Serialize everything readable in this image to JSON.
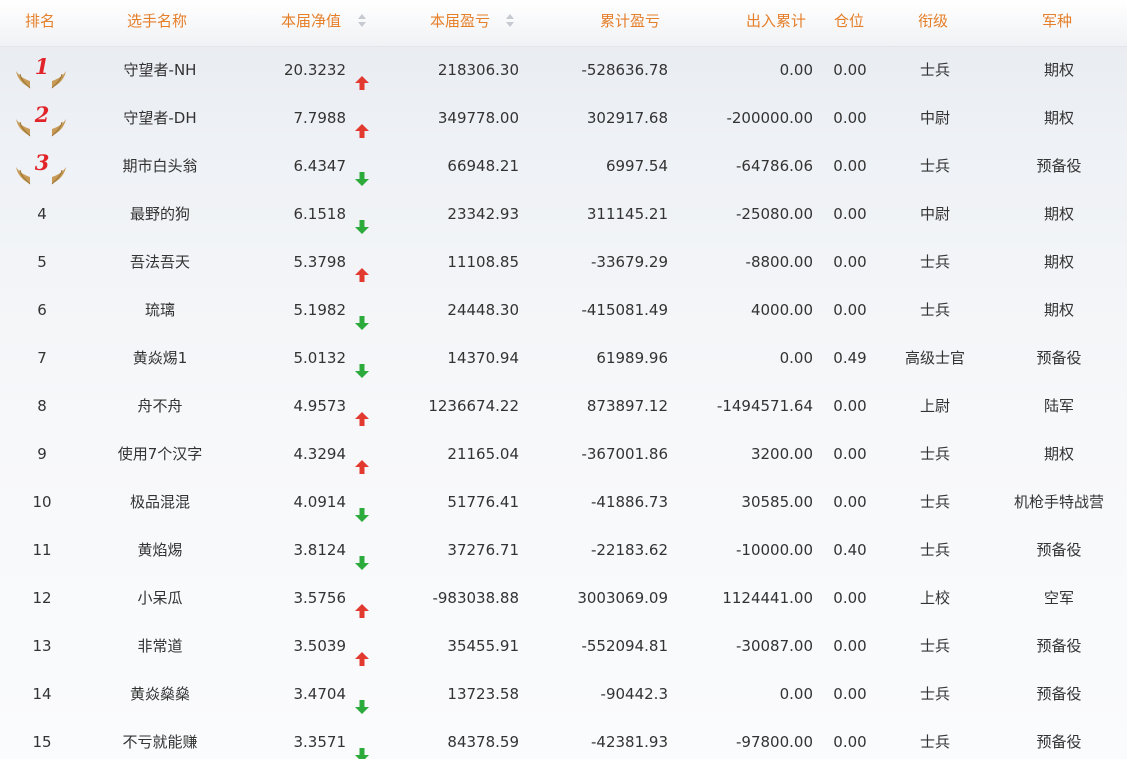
{
  "colors": {
    "header_text": "#e57f2a",
    "up_arrow": "#e23a2f",
    "down_arrow": "#2cab3c",
    "medal_number": "#e0242a",
    "wing_gold": "#c79a55"
  },
  "headers": {
    "rank": "排名",
    "name": "选手名称",
    "nav": "本届净值",
    "profit": "本届盈亏",
    "total_profit": "累计盈亏",
    "cash_flow": "出入累计",
    "position": "仓位",
    "military_rank": "衔级",
    "arm": "军种"
  },
  "rows": [
    {
      "rank": "1",
      "medal": true,
      "name": "守望者-NH",
      "nav": "20.3232",
      "trend": "up",
      "profit": "218306.30",
      "total_profit": "-528636.78",
      "cash_flow": "0.00",
      "position": "0.00",
      "military_rank": "士兵",
      "arm": "期权"
    },
    {
      "rank": "2",
      "medal": true,
      "name": "守望者-DH",
      "nav": "7.7988",
      "trend": "up",
      "profit": "349778.00",
      "total_profit": "302917.68",
      "cash_flow": "-200000.00",
      "position": "0.00",
      "military_rank": "中尉",
      "arm": "期权"
    },
    {
      "rank": "3",
      "medal": true,
      "name": "期市白头翁",
      "nav": "6.4347",
      "trend": "down",
      "profit": "66948.21",
      "total_profit": "6997.54",
      "cash_flow": "-64786.06",
      "position": "0.00",
      "military_rank": "士兵",
      "arm": "预备役"
    },
    {
      "rank": "4",
      "medal": false,
      "name": "最野的狗",
      "nav": "6.1518",
      "trend": "down",
      "profit": "23342.93",
      "total_profit": "311145.21",
      "cash_flow": "-25080.00",
      "position": "0.00",
      "military_rank": "中尉",
      "arm": "期权"
    },
    {
      "rank": "5",
      "medal": false,
      "name": "吾法吾天",
      "nav": "5.3798",
      "trend": "up",
      "profit": "11108.85",
      "total_profit": "-33679.29",
      "cash_flow": "-8800.00",
      "position": "0.00",
      "military_rank": "士兵",
      "arm": "期权"
    },
    {
      "rank": "6",
      "medal": false,
      "name": "琉璃",
      "nav": "5.1982",
      "trend": "down",
      "profit": "24448.30",
      "total_profit": "-415081.49",
      "cash_flow": "4000.00",
      "position": "0.00",
      "military_rank": "士兵",
      "arm": "期权"
    },
    {
      "rank": "7",
      "medal": false,
      "name": "黄焱焬1",
      "nav": "5.0132",
      "trend": "down",
      "profit": "14370.94",
      "total_profit": "61989.96",
      "cash_flow": "0.00",
      "position": "0.49",
      "military_rank": "高级士官",
      "arm": "预备役"
    },
    {
      "rank": "8",
      "medal": false,
      "name": "舟不舟",
      "nav": "4.9573",
      "trend": "up",
      "profit": "1236674.22",
      "total_profit": "873897.12",
      "cash_flow": "-1494571.64",
      "position": "0.00",
      "military_rank": "上尉",
      "arm": "陆军"
    },
    {
      "rank": "9",
      "medal": false,
      "name": "使用7个汉字",
      "nav": "4.3294",
      "trend": "up",
      "profit": "21165.04",
      "total_profit": "-367001.86",
      "cash_flow": "3200.00",
      "position": "0.00",
      "military_rank": "士兵",
      "arm": "期权"
    },
    {
      "rank": "10",
      "medal": false,
      "name": "极品混混",
      "nav": "4.0914",
      "trend": "down",
      "profit": "51776.41",
      "total_profit": "-41886.73",
      "cash_flow": "30585.00",
      "position": "0.00",
      "military_rank": "士兵",
      "arm": "机枪手特战营"
    },
    {
      "rank": "11",
      "medal": false,
      "name": "黄焰焬",
      "nav": "3.8124",
      "trend": "down",
      "profit": "37276.71",
      "total_profit": "-22183.62",
      "cash_flow": "-10000.00",
      "position": "0.40",
      "military_rank": "士兵",
      "arm": "预备役"
    },
    {
      "rank": "12",
      "medal": false,
      "name": "小呆瓜",
      "nav": "3.5756",
      "trend": "up",
      "profit": "-983038.88",
      "total_profit": "3003069.09",
      "cash_flow": "1124441.00",
      "position": "0.00",
      "military_rank": "上校",
      "arm": "空军"
    },
    {
      "rank": "13",
      "medal": false,
      "name": "非常道",
      "nav": "3.5039",
      "trend": "up",
      "profit": "35455.91",
      "total_profit": "-552094.81",
      "cash_flow": "-30087.00",
      "position": "0.00",
      "military_rank": "士兵",
      "arm": "预备役"
    },
    {
      "rank": "14",
      "medal": false,
      "name": "黄焱燊燊",
      "nav": "3.4704",
      "trend": "down",
      "profit": "13723.58",
      "total_profit": "-90442.3",
      "cash_flow": "0.00",
      "position": "0.00",
      "military_rank": "士兵",
      "arm": "预备役"
    },
    {
      "rank": "15",
      "medal": false,
      "name": "不亏就能赚",
      "nav": "3.3571",
      "trend": "down",
      "profit": "84378.59",
      "total_profit": "-42381.93",
      "cash_flow": "-97800.00",
      "position": "0.00",
      "military_rank": "士兵",
      "arm": "预备役"
    }
  ]
}
